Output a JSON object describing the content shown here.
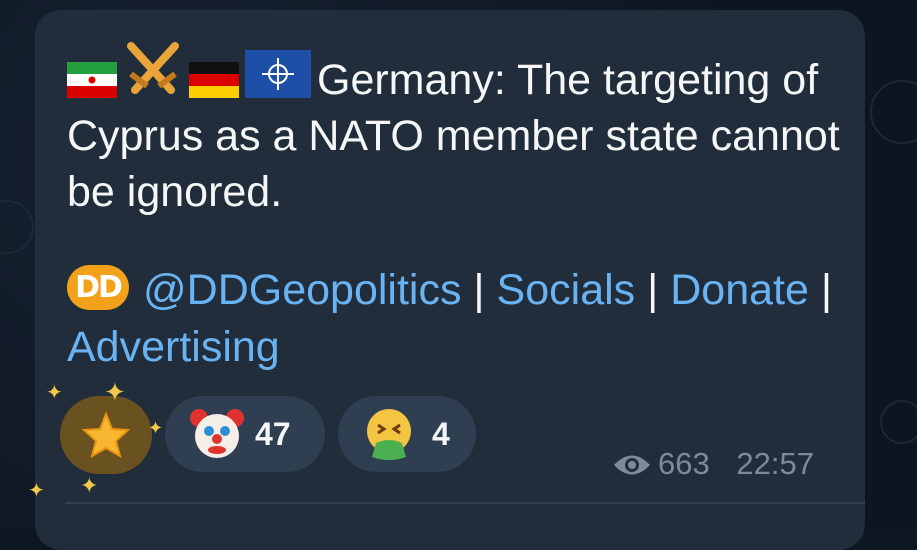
{
  "message": {
    "text": "Germany: The targeting of Cyprus as a NATO member state cannot be ignored.",
    "flags": [
      "iran-flag",
      "crossed-swords",
      "germany-flag",
      "nato-flag"
    ],
    "channel_handle": "@DDGeopolitics",
    "logo_text": "DD",
    "sep": "|",
    "links": [
      "Socials",
      "Donate",
      "Advertising"
    ]
  },
  "reactions": [
    {
      "icon": "star-icon",
      "count": ""
    },
    {
      "icon": "clown-face-icon",
      "count": "47"
    },
    {
      "icon": "vomiting-face-icon",
      "count": "4"
    }
  ],
  "meta": {
    "views": "663",
    "time": "22:57"
  },
  "colors": {
    "bubble": "#212d3b",
    "link": "#6ab3f3",
    "text": "#f5f6f7",
    "meta": "#7d8b99"
  }
}
